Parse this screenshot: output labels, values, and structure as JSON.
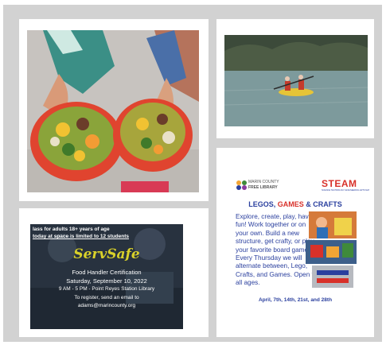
{
  "card3": {
    "top_line1": "lass for adults 18+ years of age",
    "top_line2": "today at space is limited to 12 students",
    "logo": "ServSafe",
    "title": "Food Handler Certification",
    "date": "Saturday, September 10, 2022",
    "time_place": "9 AM - 5 PM - Point Reyes Station Library",
    "register": "To register, send an email to",
    "email": "adams@marincounty.org"
  },
  "card4": {
    "org_line1": "MARIN COUNTY",
    "org_line2": "FREE LIBRARY",
    "steam": "STEAM",
    "steam_sub": "SCIENCE TECHNOLOGY ENGINEERING ARTS MATH",
    "title_a": "LEGOS, ",
    "title_b": "GAMES",
    "title_c": " & CRAFTS",
    "body": "Explore, create, play, have fun! Work together or on your own. Build a new structure, get crafty, or play your favorite board game! Every Thursday we will alternate between, Lego, Crafts, and Games. Open to all ages.",
    "dates": "April, 7th, 14th, 21st, and 28th"
  },
  "colors": {
    "frame": "#d2d2d2",
    "flyer_blue": "#2a3f9e",
    "flyer_red": "#d8312a",
    "servsafe_yellow": "#d9d12a"
  }
}
